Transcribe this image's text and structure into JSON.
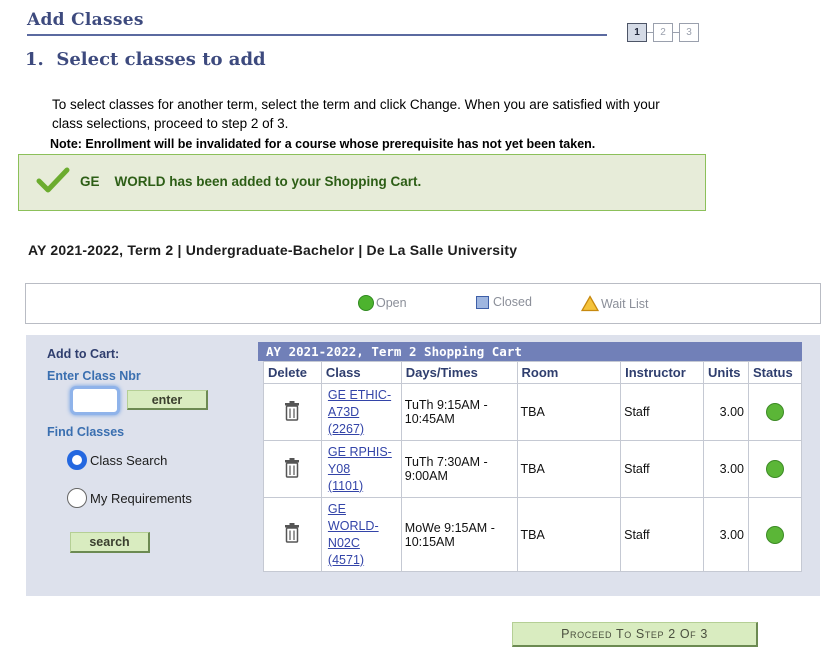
{
  "header": {
    "title": "Add Classes",
    "steps": [
      "1",
      "2",
      "3"
    ],
    "active_step": 1
  },
  "section": {
    "title": "1.  Select classes to add"
  },
  "instructions": "To select classes for another term, select the term and click Change.  When you are satisfied with your class selections, proceed to step 2 of 3.",
  "note": "Note: Enrollment will be invalidated for a course whose prerequisite has not yet been taken.",
  "message": {
    "text": "GE    WORLD has been added to your Shopping Cart.",
    "icon": "checkmark-icon",
    "color": "#2d5e16"
  },
  "term_heading": "AY 2021-2022, Term 2 | Undergraduate-Bachelor | De La Salle University",
  "legend": {
    "open": "Open",
    "closed": "Closed",
    "waitlist": "Wait List"
  },
  "add_to_cart": {
    "label": "Add to Cart:",
    "enter_label": "Enter Class Nbr",
    "class_nbr_value": "",
    "enter_button": "enter",
    "find_label": "Find Classes",
    "options": [
      {
        "label": "Class Search",
        "selected": true
      },
      {
        "label": "My Requirements",
        "selected": false
      }
    ],
    "search_button": "search"
  },
  "cart": {
    "title": "AY 2021-2022, Term 2 Shopping Cart",
    "columns": [
      "Delete",
      "Class",
      "Days/Times",
      "Room",
      "Instructor",
      "Units",
      "Status"
    ],
    "rows": [
      {
        "class_lines": [
          "GE ETHIC-",
          "A73D",
          "(2267)"
        ],
        "days_times": "TuTh 9:15AM - 10:45AM",
        "room": "TBA",
        "instructor": "Staff",
        "units": "3.00",
        "status": "open"
      },
      {
        "class_lines": [
          "GE RPHIS-",
          "Y08",
          "(1101)"
        ],
        "days_times": "TuTh 7:30AM - 9:00AM",
        "room": "TBA",
        "instructor": "Staff",
        "units": "3.00",
        "status": "open"
      },
      {
        "class_lines": [
          "GE",
          "WORLD-",
          "N02C",
          "(4571)"
        ],
        "days_times": "MoWe 9:15AM - 10:15AM",
        "room": "TBA",
        "instructor": "Staff",
        "units": "3.00",
        "status": "open"
      }
    ]
  },
  "proceed_button": "Proceed To Step 2 Of 3",
  "colors": {
    "title": "#3d4a7e",
    "open": "#5bb637",
    "cart_header": "#7180b8",
    "button": "#d9ecc0"
  }
}
